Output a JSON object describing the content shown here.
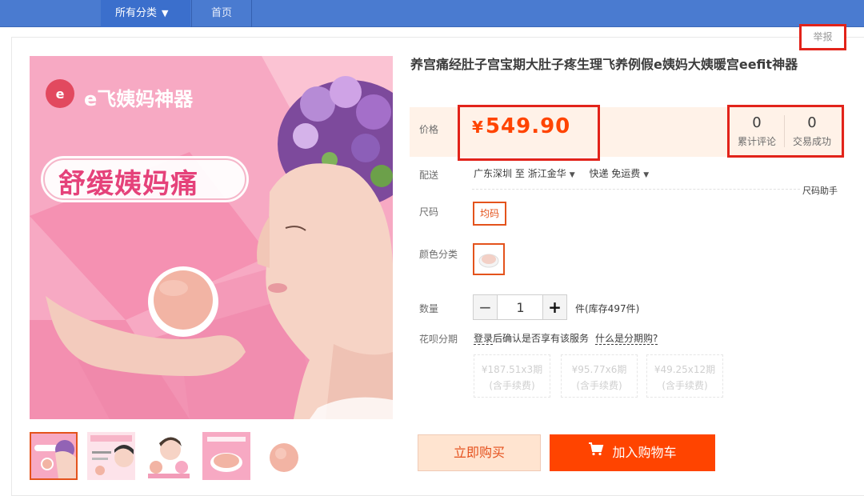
{
  "nav": {
    "categories_label": "所有分类",
    "categories_arrow": "▼",
    "home_label": "首页"
  },
  "report_label": "举报",
  "main_image": {
    "brand_text": "e飞姨妈神器",
    "banner_text": "舒缓姨妈痛"
  },
  "thumbnails": [
    {
      "label": "thumbnail-1",
      "active": true
    },
    {
      "label": "thumbnail-2",
      "active": false
    },
    {
      "label": "thumbnail-3",
      "active": false
    },
    {
      "label": "thumbnail-4",
      "active": false
    },
    {
      "label": "thumbnail-5",
      "active": false
    }
  ],
  "product": {
    "title": "养宫痛经肚子宫宝期大肚子疼生理飞养例假e姨妈大姨暖宫eefit神器",
    "price_label": "价格",
    "price_currency": "¥",
    "price_value": "549.90",
    "reviews_count": "0",
    "reviews_label": "累计评论",
    "sales_count": "0",
    "sales_label": "交易成功"
  },
  "shipping": {
    "label": "配送",
    "from": "广东深圳",
    "to_word": "至",
    "destination": "浙江金华",
    "method": "快递 免运费",
    "size_helper": "尺码助手"
  },
  "size": {
    "label": "尺码",
    "option": "均码"
  },
  "color": {
    "label": "颜色分类"
  },
  "quantity": {
    "label": "数量",
    "minus": "−",
    "value": "1",
    "plus": "+",
    "stock_text": "件(库存497件)"
  },
  "huabei": {
    "label": "花呗分期",
    "login_text": "登录",
    "info_text": "后确认是否享有该服务",
    "what_link": "什么是分期购?",
    "options": [
      {
        "price": "¥187.51x3期",
        "fee": "(含手续费)"
      },
      {
        "price": "¥95.77x6期",
        "fee": "(含手续费)"
      },
      {
        "price": "¥49.25x12期",
        "fee": "(含手续费)"
      }
    ]
  },
  "actions": {
    "buy_now": "立即购买",
    "add_to_cart": "加入购物车"
  },
  "colors": {
    "accent": "#ff4400",
    "price": "#ff4400",
    "nav": "#4a7bd0",
    "highlight_box": "#e2231a"
  }
}
